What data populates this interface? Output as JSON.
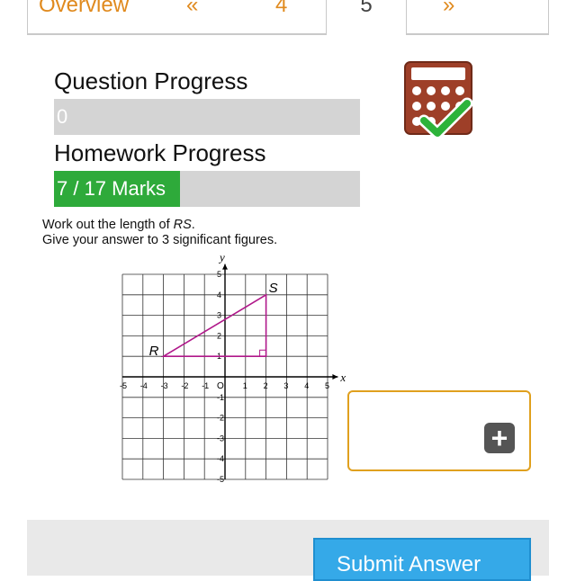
{
  "tabs": {
    "overview": "Overview",
    "prev": "«",
    "num_prev": "4",
    "current": "5",
    "next": "»"
  },
  "progress": {
    "question_heading": "Question Progress",
    "question_value": "0",
    "question_fraction": 0,
    "homework_heading": "Homework Progress",
    "homework_value": "7 / 17 Marks",
    "homework_fraction": 0.4118
  },
  "question": {
    "line1_prefix": "Work out the length of ",
    "line1_var": "RS",
    "line1_suffix": ".",
    "line2": "Give your answer to 3 significant figures."
  },
  "graph": {
    "x_label": "x",
    "y_label": "y",
    "origin_label": "O",
    "x_ticks": [
      "-5",
      "-4",
      "-3",
      "-2",
      "-1",
      "1",
      "2",
      "3",
      "4",
      "5"
    ],
    "y_ticks": [
      "5",
      "4",
      "3",
      "2",
      "1",
      "-1",
      "-2",
      "-3",
      "-4",
      "-5"
    ],
    "points": [
      {
        "label": "R",
        "x": -3,
        "y": 1
      },
      {
        "label": "S",
        "x": 2,
        "y": 4
      }
    ],
    "right_angle_corner": {
      "x": 2,
      "y": 1
    },
    "line_color": "#b0188a"
  },
  "answer": {
    "add_icon": "plus-icon"
  },
  "submit_label": "Submit Answer",
  "colors": {
    "accent_orange": "#e08a1e",
    "progress_green": "#2eaa3a",
    "submit_blue": "#35a9e8",
    "calculator_brown": "#9e3f28",
    "check_green": "#2db33a"
  }
}
